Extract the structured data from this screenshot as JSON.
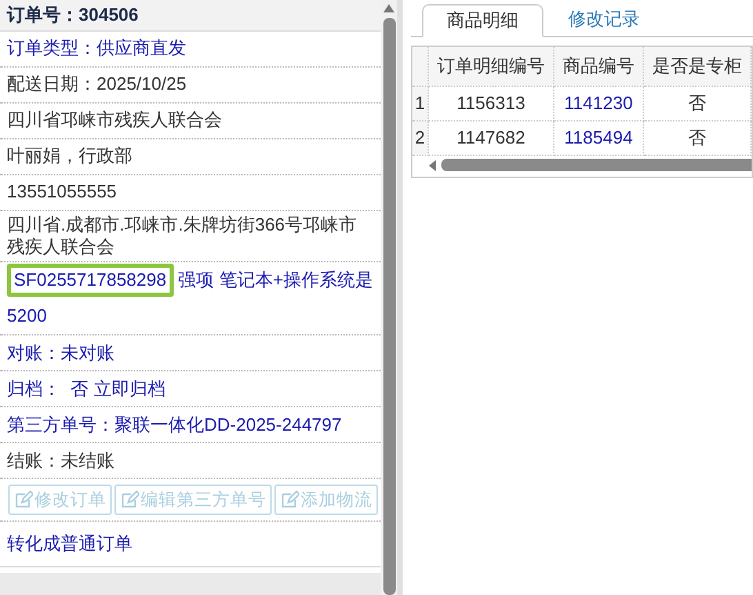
{
  "order_panel": {
    "title": "订单号：304506",
    "rows": [
      {
        "kind": "link",
        "text": "订单类型：供应商直发"
      },
      {
        "kind": "plain",
        "text": "配送日期：2025/10/25"
      },
      {
        "kind": "plain",
        "text": "四川省邛崃市残疾人联合会"
      },
      {
        "kind": "plain",
        "text": "叶丽娟，行政部"
      },
      {
        "kind": "plain",
        "text": "13551055555"
      },
      {
        "kind": "plain",
        "text": "四川省.成都市.邛崃市.朱牌坊街366号邛崃市残疾人联合会"
      },
      {
        "kind": "tracking",
        "tracking": "SF0255717858298",
        "text": "强项 笔记本+操作系统是5200"
      },
      {
        "kind": "link",
        "text": "对账：未对账"
      },
      {
        "kind": "link",
        "text": "归档：  否 立即归档"
      },
      {
        "kind": "link",
        "text": "第三方单号：聚联一体化DD-2025-244797"
      },
      {
        "kind": "plain",
        "text": "结账：未结账"
      }
    ],
    "buttons": [
      {
        "label": "修改订单",
        "disabled": true
      },
      {
        "label": "编辑第三方单号",
        "disabled": true
      },
      {
        "label": "添加物流",
        "disabled": true
      }
    ],
    "convert_link": "转化成普通订单"
  },
  "tabs": [
    {
      "label": "商品明细",
      "selected": true
    },
    {
      "label": "修改记录",
      "selected": false
    }
  ],
  "table": {
    "columns": [
      "订单明细编号",
      "商品编号",
      "是否是专柜"
    ],
    "rows": [
      {
        "index": "1",
        "cells": [
          "1156313",
          "1141230",
          "否"
        ]
      },
      {
        "index": "2",
        "cells": [
          "1147682",
          "1185494",
          "否"
        ]
      }
    ]
  }
}
